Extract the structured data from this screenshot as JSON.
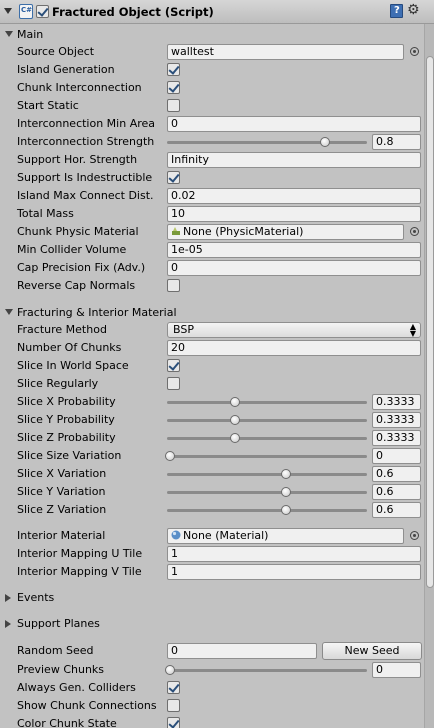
{
  "header": {
    "title": "Fractured Object (Script)",
    "enabled": true,
    "icons": [
      "foldout-arrow",
      "script-icon",
      "help-book-icon",
      "gear-icon"
    ]
  },
  "sections": {
    "main": "Main",
    "fracturing": "Fracturing & Interior Material",
    "events": "Events",
    "support_planes": "Support Planes"
  },
  "main": {
    "source_object": {
      "label": "Source Object",
      "value": "walltest"
    },
    "island_generation": {
      "label": "Island Generation",
      "checked": true
    },
    "chunk_interconnection": {
      "label": "Chunk Interconnection",
      "checked": true
    },
    "start_static": {
      "label": "Start Static",
      "checked": false
    },
    "interconnection_min_area": {
      "label": "Interconnection Min Area",
      "value": "0"
    },
    "interconnection_strength": {
      "label": "Interconnection Strength",
      "value": "0.8",
      "fraction": 0.8
    },
    "support_hor_strength": {
      "label": "Support Hor. Strength",
      "value": "Infinity"
    },
    "support_is_indestructible": {
      "label": "Support Is Indestructible",
      "checked": true
    },
    "island_max_connect_dist": {
      "label": "Island Max Connect Dist.",
      "value": "0.02"
    },
    "total_mass": {
      "label": "Total Mass",
      "value": "10"
    },
    "chunk_physic_material": {
      "label": "Chunk Physic Material",
      "value": "None (PhysicMaterial)"
    },
    "min_collider_volume": {
      "label": "Min Collider Volume",
      "value": "1e-05"
    },
    "cap_precision_fix": {
      "label": "Cap Precision Fix (Adv.)",
      "value": "0"
    },
    "reverse_cap_normals": {
      "label": "Reverse Cap Normals",
      "checked": false
    }
  },
  "fracturing": {
    "fracture_method": {
      "label": "Fracture Method",
      "value": "BSP"
    },
    "number_of_chunks": {
      "label": "Number Of Chunks",
      "value": "20"
    },
    "slice_in_world_space": {
      "label": "Slice In World Space",
      "checked": true
    },
    "slice_regularly": {
      "label": "Slice Regularly",
      "checked": false
    },
    "slice_x_probability": {
      "label": "Slice X Probability",
      "value": "0.3333",
      "fraction": 0.3333
    },
    "slice_y_probability": {
      "label": "Slice Y Probability",
      "value": "0.3333",
      "fraction": 0.3333
    },
    "slice_z_probability": {
      "label": "Slice Z Probability",
      "value": "0.3333",
      "fraction": 0.3333
    },
    "slice_size_variation": {
      "label": "Slice Size Variation",
      "value": "0",
      "fraction": 0
    },
    "slice_x_variation": {
      "label": "Slice X Variation",
      "value": "0.6",
      "fraction": 0.6
    },
    "slice_y_variation": {
      "label": "Slice Y Variation",
      "value": "0.6",
      "fraction": 0.6
    },
    "slice_z_variation": {
      "label": "Slice Z Variation",
      "value": "0.6",
      "fraction": 0.6
    },
    "interior_material": {
      "label": "Interior Material",
      "value": "None (Material)"
    },
    "interior_mapping_u": {
      "label": "Interior Mapping U Tile",
      "value": "1"
    },
    "interior_mapping_v": {
      "label": "Interior Mapping V Tile",
      "value": "1"
    }
  },
  "footer": {
    "random_seed": {
      "label": "Random Seed",
      "value": "0"
    },
    "new_seed_button": "New Seed",
    "preview_chunks": {
      "label": "Preview Chunks",
      "value": "0",
      "fraction": 0
    },
    "always_gen_colliders": {
      "label": "Always Gen. Colliders",
      "checked": true
    },
    "show_chunk_connections": {
      "label": "Show Chunk Connections",
      "checked": false
    },
    "color_chunk_state": {
      "label": "Color Chunk State",
      "checked": true
    }
  }
}
